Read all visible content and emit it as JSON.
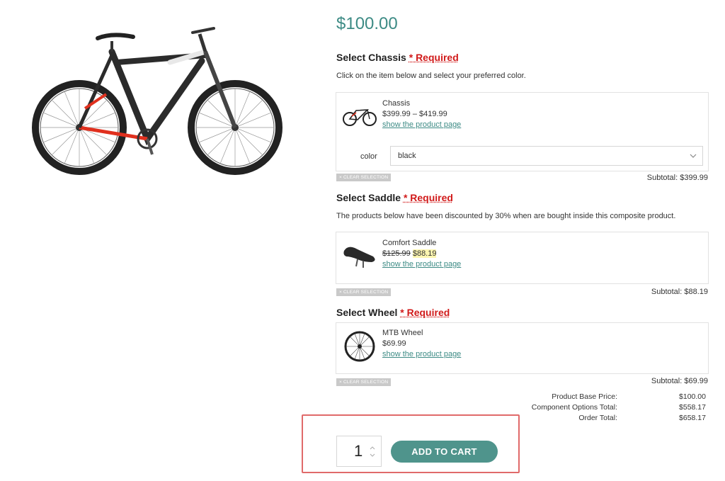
{
  "product": {
    "price": "$100.00"
  },
  "components": [
    {
      "title": "Select Chassis",
      "required": "* Required",
      "description": "Click on the item below and select your preferred color.",
      "item_name": "Chassis",
      "item_price": "$399.99 – $419.99",
      "link": "show the product page",
      "option_label": "color",
      "option_value": "black",
      "clear": "× CLEAR SELECTION",
      "subtotal": "Subtotal: $399.99"
    },
    {
      "title": "Select Saddle",
      "required": "* Required",
      "description": "The products below have been discounted by 30% when are bought inside this composite product.",
      "item_name": "Comfort Saddle",
      "old_price": "$125.99",
      "new_price": "$88.19",
      "link": "show the product page",
      "clear": "× CLEAR SELECTION",
      "subtotal": "Subtotal: $88.19"
    },
    {
      "title": "Select Wheel",
      "required": "* Required",
      "item_name": "MTB Wheel",
      "item_price": "$69.99",
      "link": "show the product page",
      "clear": "× CLEAR SELECTION",
      "subtotal": "Subtotal: $69.99"
    }
  ],
  "totals": [
    {
      "label": "Product Base Price:",
      "value": "$100.00"
    },
    {
      "label": "Component Options Total:",
      "value": "$558.17"
    },
    {
      "label": "Order Total:",
      "value": "$658.17"
    }
  ],
  "cart": {
    "quantity": "1",
    "button": "ADD TO CART"
  },
  "colors": {
    "accent": "#3d8b85",
    "required": "#d11a1a",
    "highlight": "#e06a6a"
  }
}
